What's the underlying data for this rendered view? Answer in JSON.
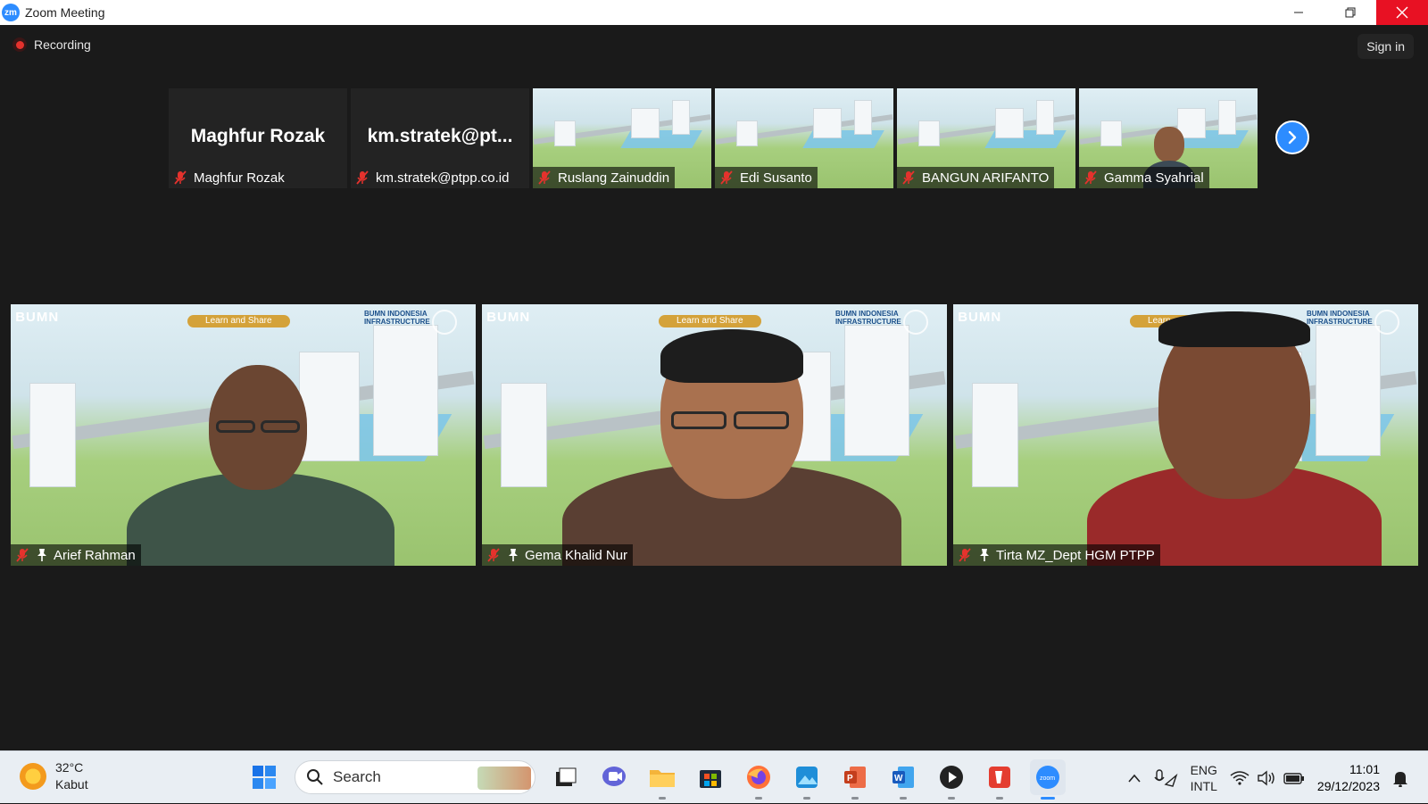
{
  "window": {
    "app_logo_text": "zm",
    "title": "Zoom Meeting"
  },
  "meeting": {
    "recording_label": "Recording",
    "sign_in_label": "Sign in",
    "thumbnails": [
      {
        "big_name": "Maghfur Rozak",
        "name": "Maghfur Rozak",
        "video": false
      },
      {
        "big_name": "km.stratek@pt...",
        "name": "km.stratek@ptpp.co.id",
        "video": false
      },
      {
        "name": "Ruslang Zainuddin",
        "video": true
      },
      {
        "name": "Edi Susanto",
        "video": true
      },
      {
        "name": "BANGUN ARIFANTO",
        "video": true
      },
      {
        "name": "Gamma Syahrial",
        "video": true
      }
    ],
    "speakers": [
      {
        "name": "Arief Rahman"
      },
      {
        "name": "Gema Khalid Nur"
      },
      {
        "name": "Tirta MZ_Dept HGM PTPP"
      }
    ],
    "background": {
      "banner": "Learn and Share",
      "logo_left": "BUMN",
      "logo_infra": "BUMN INDONESIA INFRASTRUCTURE"
    }
  },
  "taskbar": {
    "weather_temp": "32°C",
    "weather_desc": "Kabut",
    "search_placeholder": "Search",
    "lang_top": "ENG",
    "lang_bottom": "INTL",
    "time": "11:01",
    "date": "29/12/2023"
  },
  "colors": {
    "accent": "#2d8cff",
    "close": "#e81123",
    "recording": "#e5322d"
  }
}
